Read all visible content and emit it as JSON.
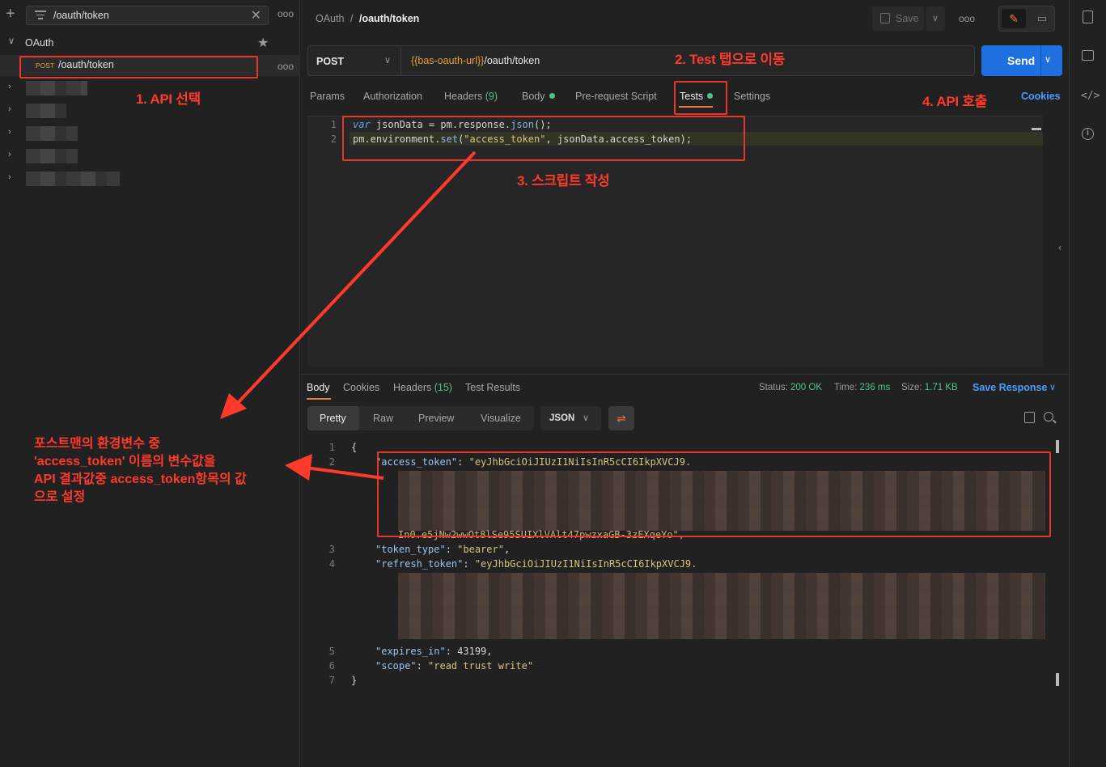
{
  "sidebar": {
    "search_value": "/oauth/token",
    "collection_name": "OAuth",
    "request": {
      "method": "POST",
      "name": "/oauth/token"
    },
    "more_label": "ooo"
  },
  "header": {
    "breadcrumb_parent": "OAuth",
    "breadcrumb_sep": "/",
    "breadcrumb_current": "/oauth/token",
    "save_label": "Save",
    "more_label": "ooo"
  },
  "request": {
    "method": "POST",
    "url_variable": "{{bas-oauth-url}}",
    "url_path": "/oauth/token",
    "send_label": "Send",
    "tabs": {
      "params": "Params",
      "authorization": "Authorization",
      "headers": "Headers",
      "headers_count": "(9)",
      "body": "Body",
      "prerequest": "Pre-request Script",
      "tests": "Tests",
      "settings": "Settings"
    },
    "cookies_label": "Cookies"
  },
  "editor": {
    "lines": [
      {
        "num": "1",
        "text": "var jsonData = pm.response.json();"
      },
      {
        "num": "2",
        "text": "pm.environment.set(\"access_token\", jsonData.access_token);"
      }
    ]
  },
  "response": {
    "tabs": {
      "body": "Body",
      "cookies": "Cookies",
      "headers": "Headers",
      "headers_count": "(15)",
      "test_results": "Test Results"
    },
    "status_label": "Status:",
    "status_value": "200 OK",
    "time_label": "Time:",
    "time_value": "236 ms",
    "size_label": "Size:",
    "size_value": "1.71 KB",
    "save_response_label": "Save Response",
    "views": {
      "pretty": "Pretty",
      "raw": "Raw",
      "preview": "Preview",
      "visualize": "Visualize"
    },
    "format": "JSON",
    "json": {
      "line_numbers": [
        "1",
        "2",
        "3",
        "4",
        "5",
        "6",
        "7"
      ],
      "open_brace": "{",
      "close_brace": "}",
      "access_token_key": "\"access_token\"",
      "access_token_start": "\"eyJhbGciOiJIUzI1NiIsInR5cCI6IkpXVCJ9.",
      "access_token_end": "In0.e5jNw2wwOt8lSe95SUIXlVAlt47pwzxaGB-3zEXqeYo\",",
      "token_type_key": "\"token_type\"",
      "token_type_value": "\"bearer\"",
      "refresh_token_key": "\"refresh_token\"",
      "refresh_token_start": "\"eyJhbGciOiJIUzI1NiIsInR5cCI6IkpXVCJ9.",
      "expires_in_key": "\"expires_in\"",
      "expires_in_value": "43199",
      "scope_key": "\"scope\"",
      "scope_value": "\"read trust write\""
    }
  },
  "annotations": {
    "step1": "1. API 선택",
    "step2": "2. Test 탭으로 이동",
    "step3": "3. 스크립트 작성",
    "step4": "4. API 호출",
    "note_line1": "포스트맨의 환경변수 중",
    "note_line2": "'access_token' 이름의 변수값을",
    "note_line3": "API 결과값중 access_token항목의 값",
    "note_line4": "으로 설정",
    "color": "#ff3a2a"
  },
  "colors": {
    "accent_orange": "#e8793c",
    "send_blue": "#1f6fe0",
    "link_blue": "#4a9eff",
    "success_green": "#4cc38a",
    "variable_orange": "#e8a033"
  }
}
